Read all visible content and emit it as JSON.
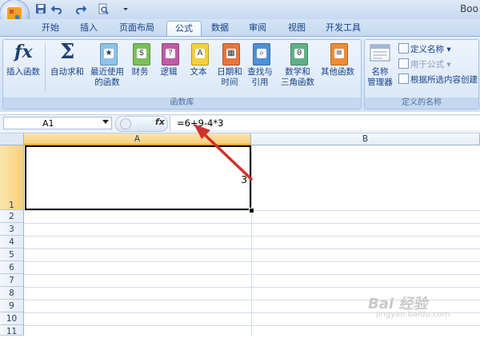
{
  "window": {
    "title": "Boo"
  },
  "tabs": [
    {
      "label": "开始"
    },
    {
      "label": "插入"
    },
    {
      "label": "页面布局"
    },
    {
      "label": "公式"
    },
    {
      "label": "数据"
    },
    {
      "label": "审阅"
    },
    {
      "label": "视图"
    },
    {
      "label": "开发工具"
    }
  ],
  "ribbon": {
    "function_library": {
      "group_label": "函数库",
      "buttons": [
        {
          "line1": "插入函数",
          "line2": "",
          "icon": "fx-icon"
        },
        {
          "line1": "自动求和",
          "line2": "",
          "icon": "sigma-icon"
        },
        {
          "line1": "最近使用",
          "line2": "的函数",
          "icon": "book-star-icon"
        },
        {
          "line1": "财务",
          "line2": "",
          "icon": "book-finance-icon"
        },
        {
          "line1": "逻辑",
          "line2": "",
          "icon": "book-question-icon"
        },
        {
          "line1": "文本",
          "line2": "",
          "icon": "book-text-icon"
        },
        {
          "line1": "日期和",
          "line2": "时间",
          "icon": "book-calendar-icon"
        },
        {
          "line1": "查找与",
          "line2": "引用",
          "icon": "book-search-icon"
        },
        {
          "line1": "数学和",
          "line2": "三角函数",
          "icon": "book-theta-icon"
        },
        {
          "line1": "其他函数",
          "line2": "",
          "icon": "book-more-icon"
        }
      ]
    },
    "defined_names": {
      "group_label": "定义的名称",
      "name_manager": {
        "line1": "名称",
        "line2": "管理器"
      },
      "items": [
        {
          "label": "定义名称"
        },
        {
          "label": "用于公式"
        },
        {
          "label": "根据所选内容创建"
        }
      ]
    }
  },
  "formula_bar": {
    "name_box": "A1",
    "fx_label": "fx",
    "formula": "=6+9-4*3"
  },
  "sheet": {
    "columns": [
      "A",
      "B"
    ],
    "rows": [
      "1",
      "2",
      "3",
      "4",
      "5",
      "6",
      "7",
      "8",
      "9",
      "10",
      "11"
    ],
    "cell_a1_value": "3"
  },
  "watermark": {
    "text": "Bai 经验",
    "sub": "jingyan.baidu.com"
  },
  "colors": {
    "accent": "#15428b",
    "annotation_arrow": "#d0312d",
    "selection_header": "#f8cf7a"
  }
}
